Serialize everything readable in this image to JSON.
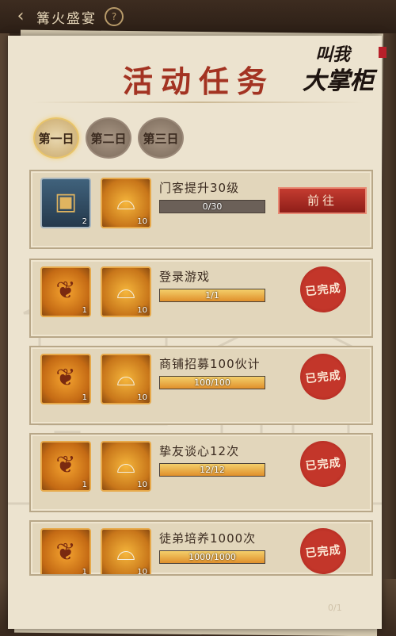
{
  "topbar": {
    "title": "篝火盛宴",
    "back_icon": "back-arrow-icon",
    "help_icon": "help-icon"
  },
  "logo": {
    "line1": "叫我",
    "line2": "大掌柜"
  },
  "heading": "活动任务",
  "day_tabs": [
    {
      "label": "第一日",
      "active": true
    },
    {
      "label": "第二日",
      "active": false
    },
    {
      "label": "第三日",
      "active": false
    }
  ],
  "tasks": [
    {
      "title": "门客提升30级",
      "progress_text": "0/30",
      "progress": 0,
      "rewards": [
        {
          "icon": "card-icon",
          "qty": "2"
        },
        {
          "icon": "silver-ingot-icon",
          "qty": "10"
        }
      ],
      "action": "前往",
      "completed": false
    },
    {
      "title": "登录游戏",
      "progress_text": "1/1",
      "progress": 1,
      "rewards": [
        {
          "icon": "roast-chicken-icon",
          "qty": "1"
        },
        {
          "icon": "silver-ingot-icon",
          "qty": "10"
        }
      ],
      "action": "已完成",
      "completed": true
    },
    {
      "title": "商铺招募100伙计",
      "progress_text": "100/100",
      "progress": 1,
      "rewards": [
        {
          "icon": "roast-chicken-icon",
          "qty": "1"
        },
        {
          "icon": "silver-ingot-icon",
          "qty": "10"
        }
      ],
      "action": "已完成",
      "completed": true
    },
    {
      "title": "挚友谈心12次",
      "progress_text": "12/12",
      "progress": 1,
      "rewards": [
        {
          "icon": "roast-chicken-icon",
          "qty": "1"
        },
        {
          "icon": "silver-ingot-icon",
          "qty": "10"
        }
      ],
      "action": "已完成",
      "completed": true
    },
    {
      "title": "徒弟培养1000次",
      "progress_text": "1000/1000",
      "progress": 1,
      "rewards": [
        {
          "icon": "roast-chicken-icon",
          "qty": "1"
        },
        {
          "icon": "silver-ingot-icon",
          "qty": "10"
        }
      ],
      "action": "已完成",
      "completed": true
    }
  ],
  "page_counter": "0/1",
  "colors": {
    "heading": "#a33322",
    "stamp": "#c3362a",
    "bar_fill": "#e0902c"
  }
}
